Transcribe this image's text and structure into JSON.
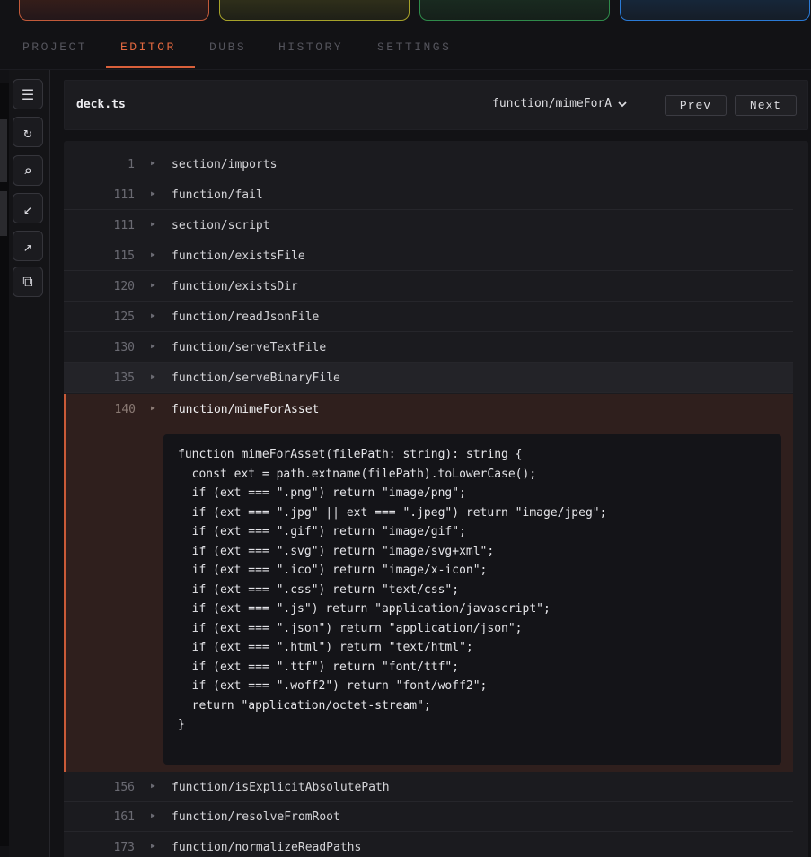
{
  "tabs": [
    {
      "label": "PROJECT"
    },
    {
      "label": "EDITOR"
    },
    {
      "label": "DUBS"
    },
    {
      "label": "HISTORY"
    },
    {
      "label": "SETTINGS"
    }
  ],
  "active_tab": "EDITOR",
  "rail": {
    "icons": [
      "menu-icon",
      "refresh-icon",
      "search-icon",
      "collapse-icon",
      "expand-icon",
      "copy-icon"
    ],
    "glyphs": [
      "☰",
      "↻",
      "⌕",
      "↙",
      "↗",
      "⧉"
    ]
  },
  "editor": {
    "filename": "deck.ts",
    "function_select": "function/mimeForA",
    "prev_label": "Prev",
    "next_label": "Next"
  },
  "rows_before": [
    {
      "num": "1",
      "label": "section/imports"
    },
    {
      "num": "111",
      "label": "function/fail"
    },
    {
      "num": "111",
      "label": "section/script"
    },
    {
      "num": "115",
      "label": "function/existsFile"
    },
    {
      "num": "120",
      "label": "function/existsDir"
    },
    {
      "num": "125",
      "label": "function/readJsonFile"
    },
    {
      "num": "130",
      "label": "function/serveTextFile"
    },
    {
      "num": "135",
      "label": "function/serveBinaryFile"
    }
  ],
  "expanded_row": {
    "num": "140",
    "label": "function/mimeForAsset",
    "code": [
      "function mimeForAsset(filePath: string): string {",
      "  const ext = path.extname(filePath).toLowerCase();",
      "  if (ext === \".png\") return \"image/png\";",
      "  if (ext === \".jpg\" || ext === \".jpeg\") return \"image/jpeg\";",
      "  if (ext === \".gif\") return \"image/gif\";",
      "  if (ext === \".svg\") return \"image/svg+xml\";",
      "  if (ext === \".ico\") return \"image/x-icon\";",
      "  if (ext === \".css\") return \"text/css\";",
      "  if (ext === \".js\") return \"application/javascript\";",
      "  if (ext === \".json\") return \"application/json\";",
      "  if (ext === \".html\") return \"text/html\";",
      "  if (ext === \".ttf\") return \"font/ttf\";",
      "  if (ext === \".woff2\") return \"font/woff2\";",
      "  return \"application/octet-stream\";",
      "}"
    ]
  },
  "rows_after": [
    {
      "num": "156",
      "label": "function/isExplicitAbsolutePath"
    },
    {
      "num": "161",
      "label": "function/resolveFromRoot"
    },
    {
      "num": "173",
      "label": "function/normalizeReadPaths"
    }
  ]
}
